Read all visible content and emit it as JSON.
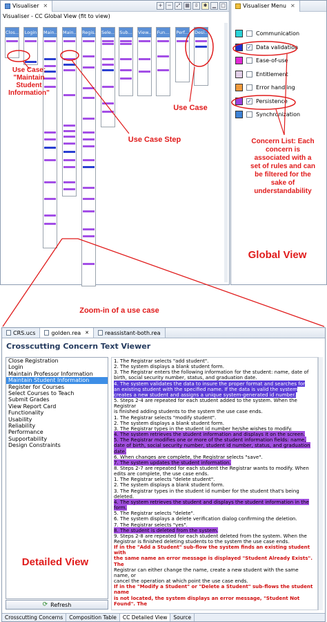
{
  "visualiser": {
    "tab_label": "Visualiser",
    "subtitle": "Visualiser - CC Global View (fit to view)",
    "use_cases": [
      {
        "label": "Clos..."
      },
      {
        "label": "Login"
      },
      {
        "label": "Main..."
      },
      {
        "label": "Main..."
      },
      {
        "label": "Regis..."
      },
      {
        "label": "Sele..."
      },
      {
        "label": "Sub..."
      },
      {
        "label": "View..."
      },
      {
        "label": "Fun..."
      },
      {
        "label": "Perf..."
      },
      {
        "label": "Desi..."
      }
    ]
  },
  "menu": {
    "tab_label": "Visualiser Menu",
    "concerns": [
      {
        "label": "Communication",
        "color": "#2ad3d8",
        "checked": false
      },
      {
        "label": "Data validation",
        "color": "#1f2fcf",
        "checked": true
      },
      {
        "label": "Ease-of-use",
        "color": "#e22bd6",
        "checked": false
      },
      {
        "label": "Entitlement",
        "color": "#e2cfe8",
        "checked": false
      },
      {
        "label": "Error handling",
        "color": "#f09a3c",
        "checked": false
      },
      {
        "label": "Persistence",
        "color": "#9b40e0",
        "checked": true
      },
      {
        "label": "Synchronization",
        "color": "#3e83d6",
        "checked": false
      }
    ]
  },
  "annotations": {
    "use_case_maintain": "Use Case: \"Maintain Student Information\"",
    "use_case": "Use Case",
    "use_case_step": "Use Case Step",
    "concern_list": "Concern List: Each concern is associated with a set of rules and can be filtered for the sake of understandability",
    "global_view": "Global View",
    "zoom_in": "Zoom-in of a use case",
    "detailed_view": "Detailed View"
  },
  "editor": {
    "tabs": [
      "CRS.ucs",
      "golden.rea",
      "reassistant-both.rea"
    ],
    "viewer_title": "Crosscutting Concern Text Viewer",
    "use_case_list": [
      "Close Registration",
      "Login",
      "Maintain Professor Information",
      "Maintain Student Information",
      "Register for Courses",
      "Select Courses to Teach",
      "Submit Grades",
      "View Report Card",
      "Functionality",
      "Usability",
      "Reliability",
      "Performance",
      "Supportability",
      "Design Constraints"
    ],
    "refresh_label": "Refresh",
    "bottom_tabs": [
      "Crosscutting Concerns",
      "Composition Table",
      "CC Detailed View",
      "Source"
    ],
    "text_lines": [
      "1. The Registrar selects \"add student\".",
      "2. The system displays a blank student form.",
      "3. The Registrar enters the following information for the student: name, date of",
      "birth, social security number, status, and graduation date.",
      "4. The system validates the data to insure the proper format and searches for",
      "an existing student with the specified name. If the data is valid the system",
      "creates a new student and assigns a unique system-generated id number.",
      "5. Steps 2-4 are repeated for each student added to the system. When the Registrar",
      "is finished adding students to the system the use case ends.",
      "1. The Registrar selects \"modify student\".",
      "2. The system displays a blank student form.",
      "3. The Registrar types in the student id number he/she wishes to modify.",
      "4. The system retrieves the student information and displays it on the screen.",
      "5. The Registrar modifies one or more of the student information fields: name,",
      "date of birth, social security number, student id number, status, and graduation",
      "date.",
      "6. When changes are complete, the Registrar selects \"save\".",
      "7. The system updates the student information.",
      "8. Steps 2-7 are repeated for each student the Registrar wants to modify. When",
      "edits are complete, the use case ends.",
      "1. The Registrar selects \"delete student\".",
      "2. The system displays a blank student form.",
      "3. The Registrar types in the student id number for the student that's being deleted.",
      "4. The system retrieves the student and displays the student information in the",
      "form.",
      "5. The Registrar selects \"delete\".",
      "6. The system displays a delete verification dialog confirming the deletion.",
      "7. The Registrar selects \"yes\".",
      "8. The student is deleted from the system.",
      "9. Steps 2-8 are repeated for each student deleted from the system. When the",
      "Registrar is finished deleting students to the system the use case ends.",
      "If in the \"Add a Student\" sub-flow the system finds an existing student with",
      "the same name an error message is displayed \"Student Already Exists\". The",
      "Registrar can either change the name, create a new student with the same name, or",
      "cancel the operation at which point the use case ends.",
      "If in the \"Modify a Student\" or \"Delete a Student\" sub-flows the student name",
      "is not located, the system displays an error message, \"Student Not Found\". The"
    ]
  }
}
